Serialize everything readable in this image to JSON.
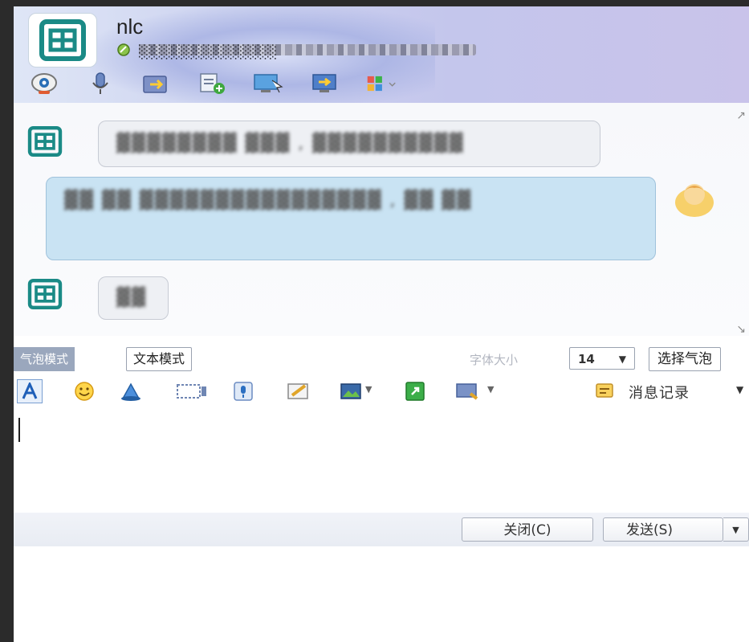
{
  "header": {
    "contact_name": "nlc",
    "status_text": "░░░░░░░░░░░░░░",
    "tools": [
      "video-call-icon",
      "voice-call-icon",
      "send-file-icon",
      "create-discussion-icon",
      "remote-desktop-icon",
      "share-screen-icon",
      "apps-icon"
    ]
  },
  "messages": [
    {
      "direction": "in",
      "text": "▓▓▓▓▓▓▓▓ ▓▓▓ , ▓▓▓▓▓▓▓▓▓▓"
    },
    {
      "direction": "out",
      "text": "▓▓ ▓▓ ▓▓▓▓▓▓▓▓▓▓▓▓▓▓▓▓ , ▓▓ ▓▓"
    },
    {
      "direction": "in",
      "text": "▓▓"
    }
  ],
  "modebar": {
    "bubble_mode": "气泡模式",
    "text_mode": "文本模式",
    "font_size_label": "字体大小",
    "font_size_value": "14",
    "choose_bubble": "选择气泡"
  },
  "toolbar": {
    "items": [
      "font-icon",
      "emoji-icon",
      "magic-icon",
      "screenshot-icon",
      "voice-message-icon",
      "edit-icon",
      "image-icon",
      "send-image-icon",
      "more-icon"
    ],
    "history_label": "消息记录"
  },
  "bottom": {
    "close_label": "关闭(C)",
    "send_label": "发送(S)"
  }
}
